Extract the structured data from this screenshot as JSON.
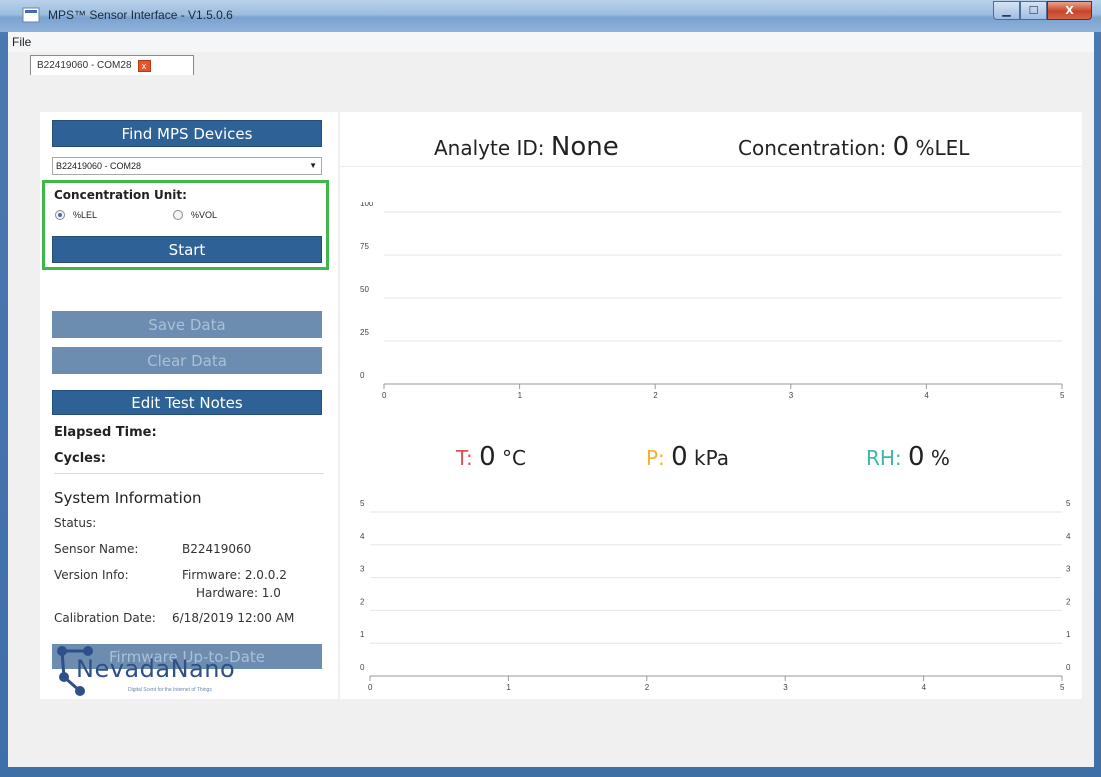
{
  "window": {
    "title": "MPS™ Sensor Interface - V1.5.0.6",
    "min_label": "▁",
    "max_label": "☐",
    "close_label": "X"
  },
  "menu": {
    "file": "File"
  },
  "tab": {
    "label": "B22419060 - COM28",
    "close_label": "x"
  },
  "left": {
    "find_button": "Find MPS Devices",
    "device_select": "B22419060 - COM28",
    "unit_label": "Concentration Unit:",
    "unit_options": [
      "%LEL",
      "%VOL"
    ],
    "unit_selected": "%LEL",
    "start_button": "Start",
    "save_button": "Save Data",
    "clear_button": "Clear Data",
    "notes_button": "Edit Test Notes",
    "elapsed_label": "Elapsed Time:",
    "cycles_label": "Cycles:",
    "system_title": "System Information",
    "status_label": "Status:",
    "sensor_name_label": "Sensor Name:",
    "sensor_name_value": "B22419060",
    "version_label": "Version Info:",
    "firmware_value": "Firmware: 2.0.0.2",
    "hardware_value": "Hardware: 1.0",
    "calibration_label": "Calibration Date:",
    "calibration_value": "6/18/2019 12:00 AM",
    "firmware_button": "Firmware Up-to-Date",
    "logo_text": "NevadaNano",
    "logo_tagline": "Digital Scent for the Internet of Things"
  },
  "concentration_panel": {
    "analyte_label": "Analyte ID: ",
    "analyte_value": "None",
    "concentration_label": "Concentration: ",
    "concentration_value": "0",
    "concentration_unit": " %LEL"
  },
  "environment_panel": {
    "t_label": "T: ",
    "t_value": "0",
    "t_unit": " °C",
    "p_label": "P: ",
    "p_value": "0",
    "p_unit": " kPa",
    "rh_label": "RH: ",
    "rh_value": "0",
    "rh_unit": " %",
    "colors": {
      "t": "#d9534f",
      "p": "#f0b030",
      "rh": "#3cb8a8"
    }
  },
  "chart_data": [
    {
      "type": "line",
      "x_ticks": [
        "0",
        "1",
        "2",
        "3",
        "4",
        "5"
      ],
      "y_ticks": [
        "0",
        "25",
        "50",
        "75",
        "100"
      ],
      "xlim": [
        0,
        5
      ],
      "ylim": [
        0,
        100
      ],
      "series": [],
      "grid": true
    },
    {
      "type": "line",
      "x_ticks": [
        "0",
        "1",
        "2",
        "3",
        "4",
        "5"
      ],
      "y_ticks": [
        "0",
        "1",
        "2",
        "3",
        "4",
        "5"
      ],
      "y2_ticks": [
        "0",
        "1",
        "2",
        "3",
        "4",
        "5"
      ],
      "xlim": [
        0,
        5
      ],
      "ylim": [
        0,
        5
      ],
      "series": [],
      "grid": true
    }
  ]
}
